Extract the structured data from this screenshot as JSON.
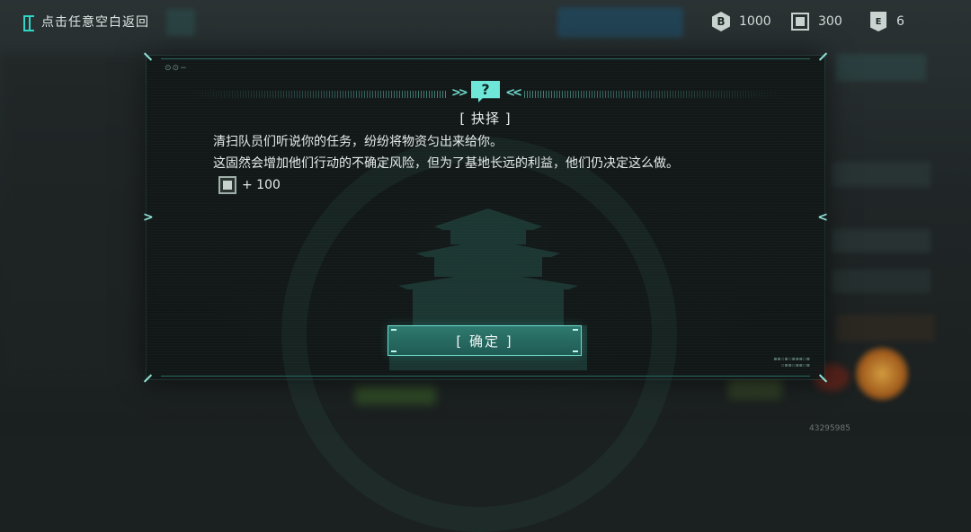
{
  "header": {
    "back_label": "点击任意空白返回"
  },
  "resources": [
    {
      "icon": "coin-icon",
      "icon_glyph": "B",
      "value": "1000"
    },
    {
      "icon": "supply-crate-icon",
      "value": "300"
    },
    {
      "icon": "badge-icon",
      "icon_glyph": "E",
      "value": "6"
    }
  ],
  "dialog": {
    "question_glyph": "?",
    "title": "[ 抉择 ]",
    "lines": [
      "清扫队员们听说你的任务，纷纷将物资匀出来给你。",
      "这固然会增加他们行动的不确定风险，但为了基地长远的利益，他们仍决定这么做。"
    ],
    "reward": {
      "icon": "supply-crate-icon",
      "text": "+ 100"
    },
    "confirm_label": "[ 确定 ]"
  },
  "footer": {
    "uid": "43295985"
  },
  "colors": {
    "accent": "#6fdccd",
    "accent_dark": "#1f5a53",
    "text": "#e7ecec"
  }
}
